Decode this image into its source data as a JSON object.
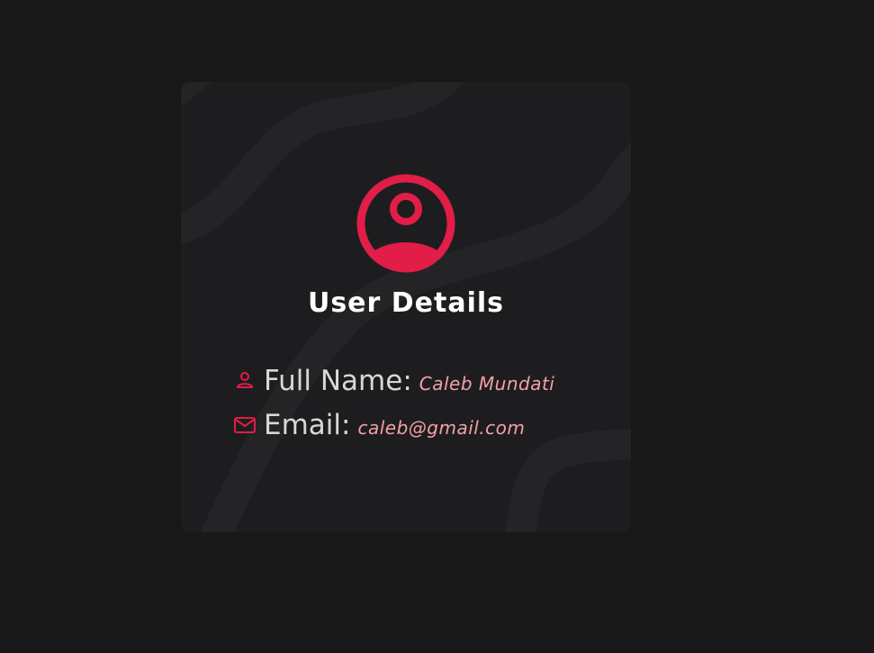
{
  "card": {
    "title": "User Details",
    "avatar_icon": "user-circle-icon",
    "fields": {
      "name": {
        "icon": "person-icon",
        "label": "Full Name:",
        "value": "Caleb Mundati"
      },
      "email": {
        "icon": "mail-icon",
        "label": "Email:",
        "value": "caleb@gmail.com"
      }
    }
  },
  "colors": {
    "background": "#181818",
    "card": "#1d1d1f",
    "accent": "#e11d48",
    "label": "#d8d8d8",
    "value": "#f3a0a8"
  }
}
